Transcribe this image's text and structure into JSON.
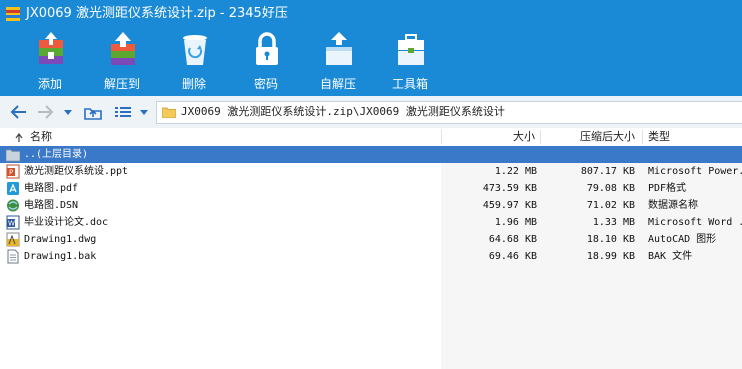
{
  "window": {
    "title": "JX0069 激光测距仪系统设计.zip - 2345好压"
  },
  "ribbon": {
    "buttons": [
      {
        "label": "添加",
        "icon": "add-archive-icon"
      },
      {
        "label": "解压到",
        "icon": "extract-to-icon"
      },
      {
        "label": "删除",
        "icon": "trash-icon"
      },
      {
        "label": "密码",
        "icon": "lock-icon"
      },
      {
        "label": "自解压",
        "icon": "self-extract-icon"
      },
      {
        "label": "工具箱",
        "icon": "toolbox-icon"
      }
    ]
  },
  "navbar": {
    "path": "JX0069 激光测距仪系统设计.zip\\JX0069 激光测距仪系统设计"
  },
  "columns": {
    "name": "名称",
    "size": "大小",
    "compressed": "压缩后大小",
    "type": "类型"
  },
  "parent_row": {
    "label": "..(上层目录)"
  },
  "files": [
    {
      "name": "激光测距仪系统设.ppt",
      "size": "1.22 MB",
      "compressed": "807.17 KB",
      "type": "Microsoft Power...",
      "icon": "ppt-file-icon"
    },
    {
      "name": "电路图.pdf",
      "size": "473.59 KB",
      "compressed": "79.08 KB",
      "type": "PDF格式",
      "icon": "pdf-file-icon"
    },
    {
      "name": "电路图.DSN",
      "size": "459.97 KB",
      "compressed": "71.02 KB",
      "type": "数据源名称",
      "icon": "dsn-file-icon"
    },
    {
      "name": "毕业设计论文.doc",
      "size": "1.96 MB",
      "compressed": "1.33 MB",
      "type": "Microsoft Word ...",
      "icon": "word-file-icon"
    },
    {
      "name": "Drawing1.dwg",
      "size": "64.68 KB",
      "compressed": "18.10 KB",
      "type": "AutoCAD 图形",
      "icon": "dwg-file-icon"
    },
    {
      "name": "Drawing1.bak",
      "size": "69.46 KB",
      "compressed": "18.99 KB",
      "type": "BAK 文件",
      "icon": "bak-file-icon"
    }
  ],
  "colors": {
    "titlebar": "#1a8ad6",
    "selection": "#3a79c8"
  }
}
